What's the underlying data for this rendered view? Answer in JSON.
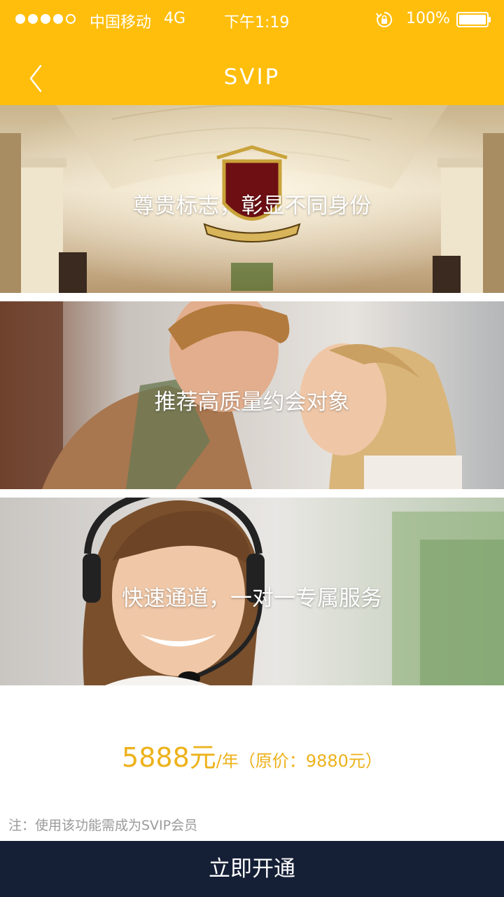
{
  "status_bar": {
    "carrier": "中国移动",
    "network": "4G",
    "time": "下午1:19",
    "battery": "100%"
  },
  "nav": {
    "title": "SVIP",
    "back_icon": "chevron-left-icon"
  },
  "banners": [
    {
      "caption": "尊贵标志，彰显不同身份",
      "scene": "palace-hall-crest"
    },
    {
      "caption": "推荐高质量约会对象",
      "scene": "couple"
    },
    {
      "caption": "快速通道，一对一专属服务",
      "scene": "headset-agent"
    }
  ],
  "pricing": {
    "amount": "5888元",
    "suffix": "/年（原价：9880元）"
  },
  "note": "注：使用该功能需成为SVIP会员",
  "cta": {
    "label": "立即开通"
  },
  "colors": {
    "header": "#FFBE0C",
    "price": "#EDB21B",
    "cta_bg": "#151F36",
    "note": "#9a9a9a"
  }
}
